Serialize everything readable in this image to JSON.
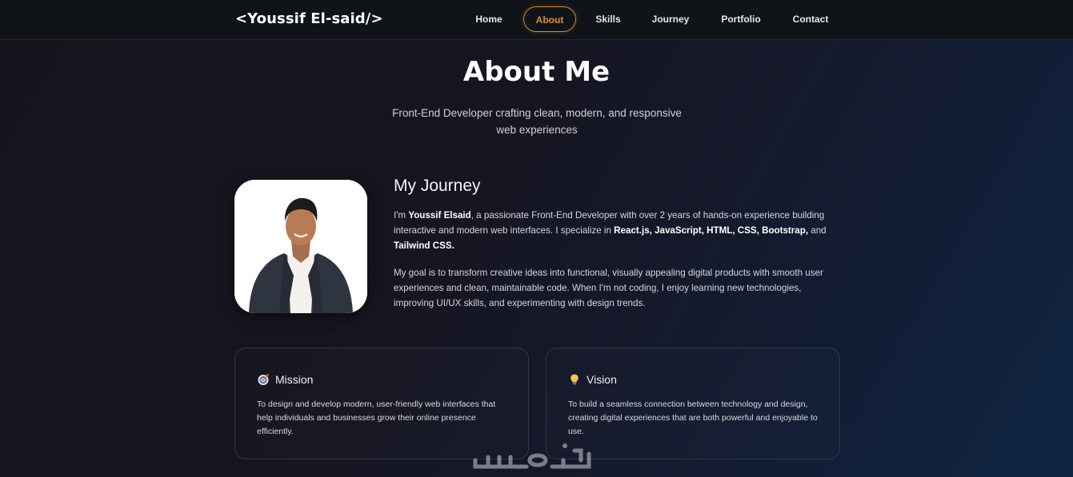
{
  "header": {
    "brand": "<Youssif El-said/>",
    "nav": [
      {
        "label": "Home"
      },
      {
        "label": "About"
      },
      {
        "label": "Skills"
      },
      {
        "label": "Journey"
      },
      {
        "label": "Portfolio"
      },
      {
        "label": "Contact"
      }
    ],
    "active": "About"
  },
  "hero": {
    "title": "About Me",
    "subtitle": "Front-End Developer crafting clean, modern, and responsive web experiences"
  },
  "journey": {
    "heading": "My Journey",
    "p1": {
      "t1": "I'm ",
      "name": "Youssif Elsaid",
      "t2": ", a passionate Front-End Developer with over 2 years of hands-on experience building interactive and modern web interfaces. I specialize in ",
      "skills": "React.js, JavaScript, HTML, CSS, Bootstrap,",
      "t3": " and ",
      "skill_last": "Tailwind CSS."
    },
    "p2": "My goal is to transform creative ideas into functional, visually appealing digital products with smooth user experiences and clean, maintainable code. When I'm not coding, I enjoy learning new technologies, improving UI/UX skills, and experimenting with design trends."
  },
  "cards": [
    {
      "icon": "target-icon",
      "title": "Mission",
      "text": "To design and develop modern, user-friendly web interfaces that help individuals and businesses grow their online presence efficiently."
    },
    {
      "icon": "lightbulb-icon",
      "title": "Vision",
      "text": "To build a seamless connection between technology and design, creating digital experiences that are both powerful and enjoyable to use."
    }
  ],
  "colors": {
    "accent": "#d5872c",
    "background_start": "#16131c",
    "background_end": "#0e2443"
  }
}
